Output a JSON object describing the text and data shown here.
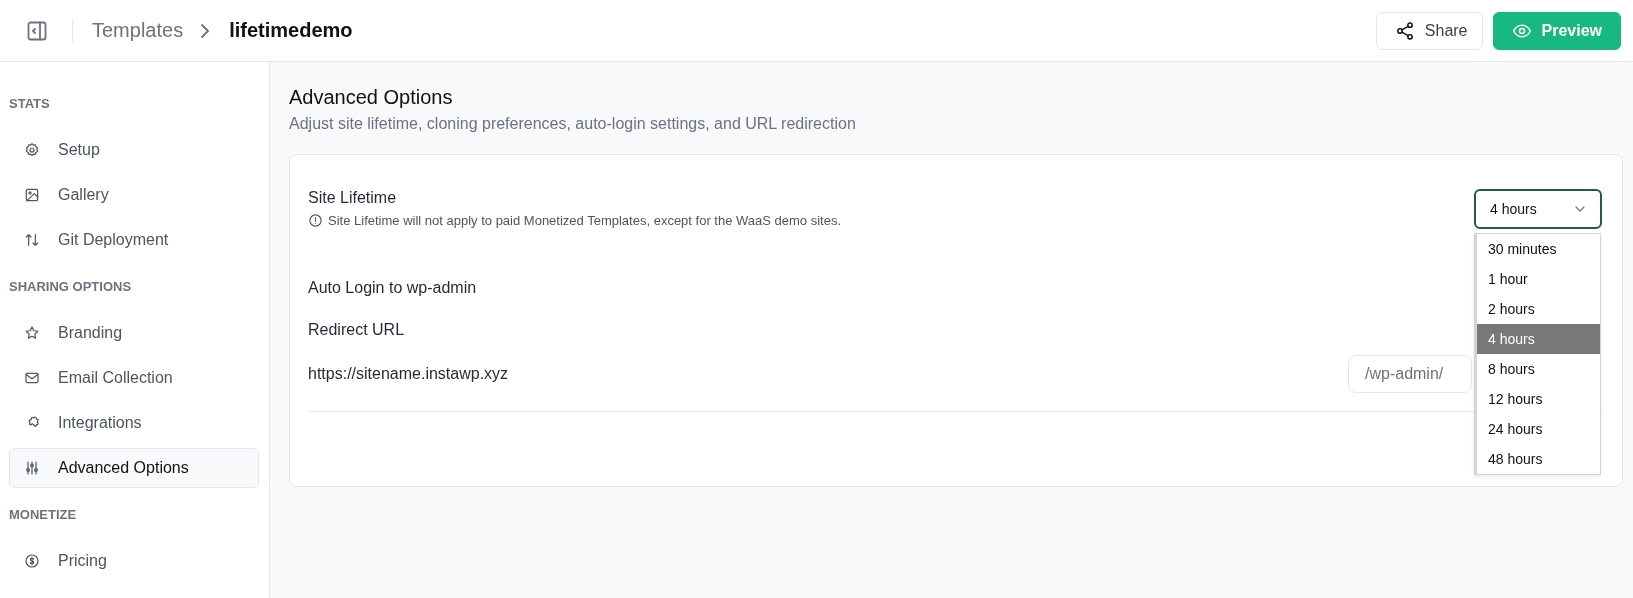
{
  "header": {
    "breadcrumb": [
      {
        "label": "Templates",
        "current": false
      },
      {
        "label": "lifetimedemo",
        "current": true
      }
    ],
    "buttons": [
      {
        "label": "Share",
        "kind": "secondary"
      },
      {
        "label": "Preview",
        "kind": "primary"
      }
    ]
  },
  "sidebar": {
    "sections": [
      {
        "title": "STATS",
        "items": [
          {
            "label": "Setup",
            "selected": false
          },
          {
            "label": "Gallery",
            "selected": false
          },
          {
            "label": "Git Deployment",
            "selected": false
          }
        ]
      },
      {
        "title": "SHARING OPTIONS",
        "items": [
          {
            "label": "Branding",
            "selected": false
          },
          {
            "label": "Email Collection",
            "selected": false
          },
          {
            "label": "Integrations",
            "selected": false
          },
          {
            "label": "Advanced Options",
            "selected": true
          }
        ]
      },
      {
        "title": "MONETIZE",
        "items": [
          {
            "label": "Pricing",
            "selected": false
          }
        ]
      }
    ]
  },
  "page": {
    "title": "Advanced Options",
    "subtitle": "Adjust site lifetime, cloning preferences, auto-login settings, and URL redirection"
  },
  "site_lifetime": {
    "label": "Site Lifetime",
    "note": "Site Lifetime will not apply to paid Monetized Templates, except for the WaaS demo sites.",
    "select": {
      "value": "4 hours",
      "expanded": true,
      "options": [
        {
          "label": "30 minutes",
          "selected": false
        },
        {
          "label": "1 hour",
          "selected": false
        },
        {
          "label": "2 hours",
          "selected": false
        },
        {
          "label": "4 hours",
          "selected": true
        },
        {
          "label": "8 hours",
          "selected": false
        },
        {
          "label": "12 hours",
          "selected": false
        },
        {
          "label": "24 hours",
          "selected": false
        },
        {
          "label": "48 hours",
          "selected": false
        }
      ]
    }
  },
  "auto_login": {
    "label": "Auto Login to wp-admin"
  },
  "redirect": {
    "label": "Redirect URL",
    "base": "https://sitename.instawp.xyz",
    "path": {
      "value": "/wp-admin/"
    }
  }
}
